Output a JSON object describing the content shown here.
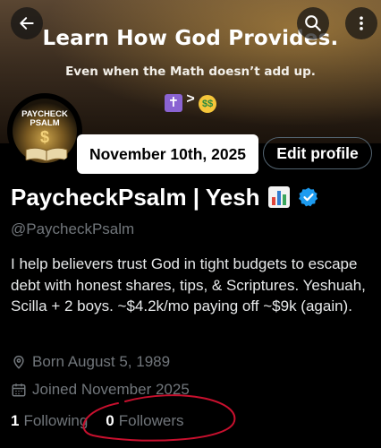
{
  "banner": {
    "title": "Learn How God Provides.",
    "subtitle": "Even when the Math doesn’t add up.",
    "emoji_operator": ">"
  },
  "avatar": {
    "text_line1": "PAYCHECK",
    "text_line2": "PSALM",
    "symbol": "$"
  },
  "date_overlay": "November 10th, 2025",
  "edit_profile_label": "Edit profile",
  "profile": {
    "name": "PaycheckPsalm | Yesh",
    "handle": "@PaycheckPsalm",
    "bio": "I help believers trust God in tight budgets to escape debt with honest shares, tips, & Scriptures. Yeshuah, Scilla + 2 boys. ~$4.2k/mo paying off ~$9k (again).",
    "born": "Born August 5, 1989",
    "joined": "Joined November 2025"
  },
  "stats": {
    "following_count": "1",
    "following_label": "Following",
    "followers_count": "0",
    "followers_label": "Followers"
  },
  "colors": {
    "verified": "#1d9bf0",
    "annotation": "#c8102e",
    "muted": "#71767b"
  },
  "icons": [
    "back-arrow-icon",
    "search-icon",
    "more-vertical-icon",
    "location-icon",
    "calendar-icon",
    "verified-badge-icon",
    "bar-chart-emoji-icon",
    "cross-emoji-icon",
    "money-face-emoji-icon"
  ]
}
